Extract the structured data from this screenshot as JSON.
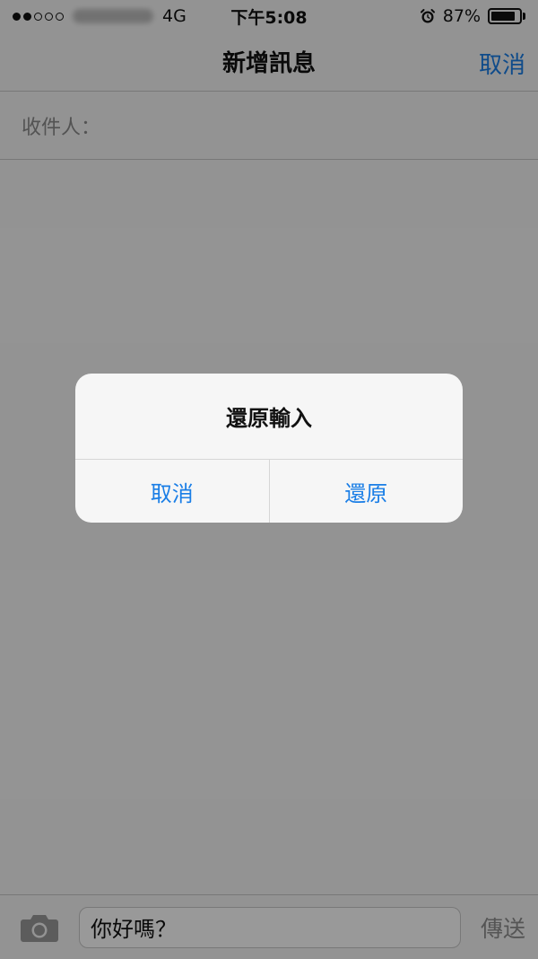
{
  "status_bar": {
    "network": "4G",
    "time": "下午5:08",
    "battery_percent": "87%",
    "battery_level": 0.87
  },
  "nav": {
    "title": "新增訊息",
    "cancel_label": "取消"
  },
  "recipient": {
    "label": "收件人："
  },
  "compose": {
    "message_text": "你好嗎？",
    "send_label": "傳送"
  },
  "alert": {
    "title": "還原輸入",
    "cancel_label": "取消",
    "undo_label": "還原"
  },
  "colors": {
    "accent": "#1a7ee6"
  }
}
